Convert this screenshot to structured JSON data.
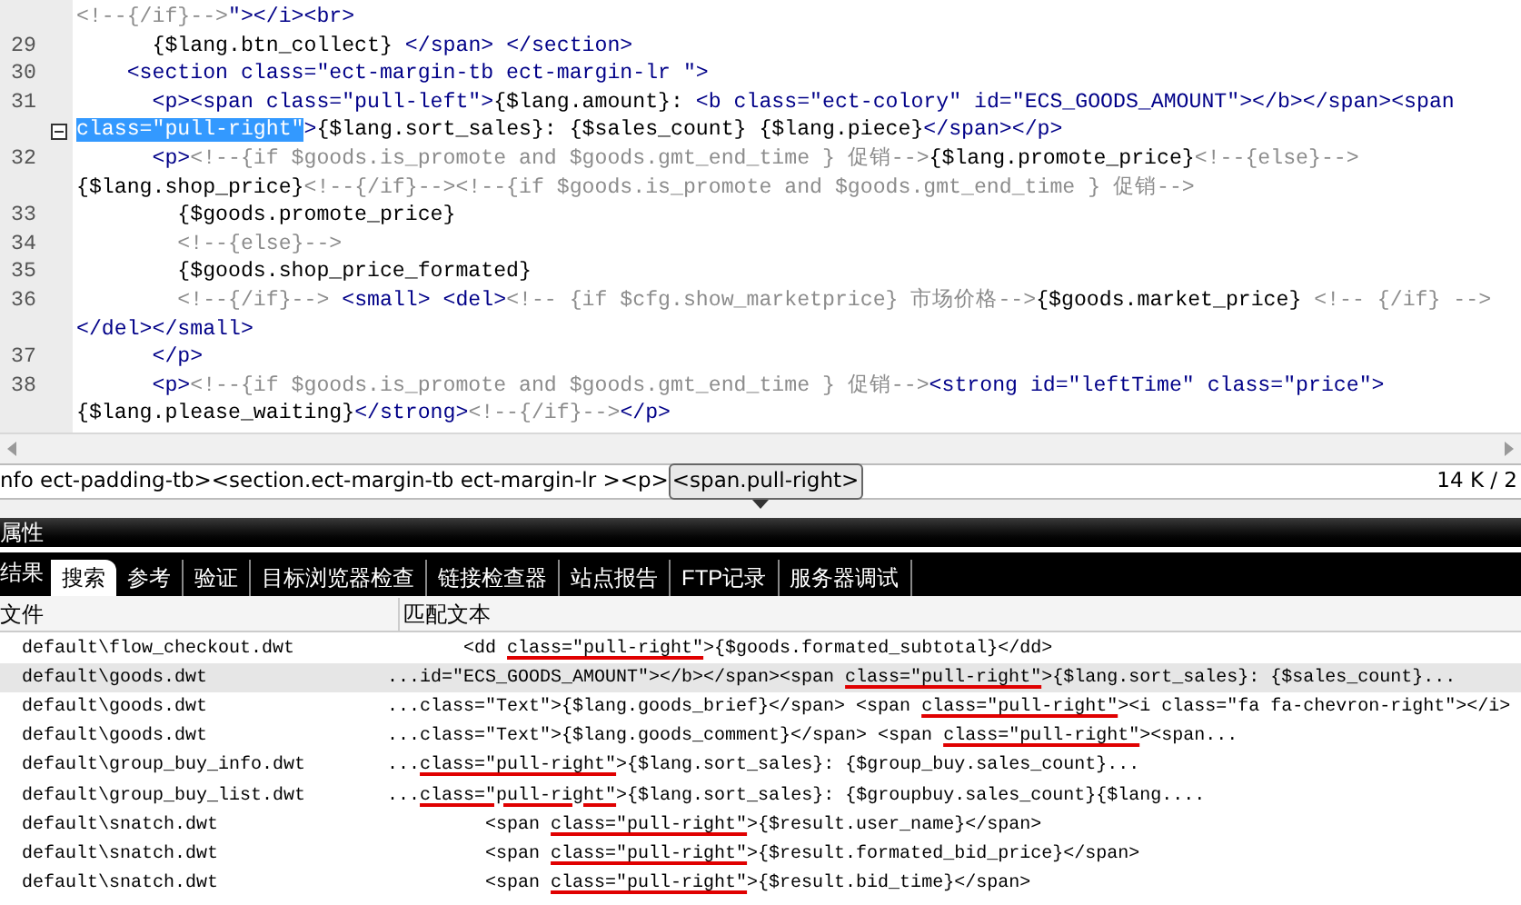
{
  "editor": {
    "lines": [
      {
        "fold": false,
        "segments": [
          {
            "kind": "comment",
            "text": "<!--{/if}-->"
          },
          {
            "kind": "tag",
            "text": "\"></i><br>"
          }
        ]
      },
      {
        "number": "29",
        "fold": false,
        "segments": [
          {
            "kind": "code",
            "text": "      {$lang.btn_collect} "
          },
          {
            "kind": "tag",
            "text": "</span> </section>"
          }
        ]
      },
      {
        "number": "30",
        "fold": false,
        "segments": [
          {
            "kind": "tag",
            "text": "    <section class=\"ect-margin-tb ect-margin-lr \">"
          }
        ]
      },
      {
        "number": "31",
        "fold": false,
        "segments": [
          {
            "kind": "tag",
            "text": "      <p><span class=\"pull-left\">"
          },
          {
            "kind": "code",
            "text": "{$lang.amount}: "
          },
          {
            "kind": "tag",
            "text": "<b class=\"ect-colory\" id=\"ECS_GOODS_AMOUNT\"></b></span><span"
          }
        ]
      },
      {
        "fold": true,
        "segments": [
          {
            "kind": "selection",
            "text": "class=\"pull-right\""
          },
          {
            "kind": "tag",
            "text": ">"
          },
          {
            "kind": "code",
            "text": "{$lang.sort_sales}: {$sales_count} {$lang.piece}"
          },
          {
            "kind": "tag",
            "text": "</span></p>"
          }
        ]
      },
      {
        "number": "32",
        "fold": false,
        "segments": [
          {
            "kind": "tag",
            "text": "      <p>"
          },
          {
            "kind": "comment",
            "text": "<!--{if $goods.is_promote and $goods.gmt_end_time } 促销-->"
          },
          {
            "kind": "code",
            "text": "{$lang.promote_price}"
          },
          {
            "kind": "comment",
            "text": "<!--{else}-->"
          }
        ]
      },
      {
        "fold": false,
        "segments": [
          {
            "kind": "code",
            "text": "{$lang.shop_price}"
          },
          {
            "kind": "comment",
            "text": "<!--{/if}--><!--{if $goods.is_promote and $goods.gmt_end_time } 促销-->"
          }
        ]
      },
      {
        "number": "33",
        "fold": false,
        "segments": [
          {
            "kind": "code",
            "text": "        {$goods.promote_price}"
          }
        ]
      },
      {
        "number": "34",
        "fold": false,
        "segments": [
          {
            "kind": "comment",
            "text": "        <!--{else}-->"
          }
        ]
      },
      {
        "number": "35",
        "fold": false,
        "segments": [
          {
            "kind": "code",
            "text": "        {$goods.shop_price_formated}"
          }
        ]
      },
      {
        "number": "36",
        "fold": false,
        "segments": [
          {
            "kind": "comment",
            "text": "        <!--{/if}--> "
          },
          {
            "kind": "tag",
            "text": "<small> <del>"
          },
          {
            "kind": "comment",
            "text": "<!-- {if $cfg.show_marketprice} 市场价格-->"
          },
          {
            "kind": "code",
            "text": "{$goods.market_price} "
          },
          {
            "kind": "comment",
            "text": "<!-- {/if} -->"
          }
        ]
      },
      {
        "fold": false,
        "segments": [
          {
            "kind": "tag",
            "text": "</del></small>"
          }
        ]
      },
      {
        "number": "37",
        "fold": false,
        "segments": [
          {
            "kind": "tag",
            "text": "      </p>"
          }
        ]
      },
      {
        "number": "38",
        "fold": false,
        "segments": [
          {
            "kind": "tag",
            "text": "      <p>"
          },
          {
            "kind": "comment",
            "text": "<!--{if $goods.is_promote and $goods.gmt_end_time } 促销-->"
          },
          {
            "kind": "tag",
            "text": "<strong id=\"leftTime\" class=\"price\">"
          }
        ]
      },
      {
        "fold": false,
        "segments": [
          {
            "kind": "code",
            "text": "{$lang.please_waiting}"
          },
          {
            "kind": "tag",
            "text": "</strong>"
          },
          {
            "kind": "comment",
            "text": "<!--{/if}-->"
          },
          {
            "kind": "tag",
            "text": "</p>"
          }
        ]
      }
    ]
  },
  "tag_selector": {
    "items": [
      {
        "label": "nfo ect-padding-tb>",
        "selected": false
      },
      {
        "label": "<section.ect-margin-tb ect-margin-lr >",
        "selected": false
      },
      {
        "label": "<p>",
        "selected": false
      },
      {
        "label": "<span.pull-right>",
        "selected": true
      }
    ],
    "size": "14 K / 2"
  },
  "properties_panel": {
    "title": "属性"
  },
  "results_panel": {
    "title": "结果",
    "tabs": [
      {
        "label": "搜索",
        "selected": true
      },
      {
        "label": "参考",
        "selected": false
      },
      {
        "label": "验证",
        "selected": false
      },
      {
        "label": "目标浏览器检查",
        "selected": false
      },
      {
        "label": "链接检查器",
        "selected": false
      },
      {
        "label": "站点报告",
        "selected": false
      },
      {
        "label": "FTP记录",
        "selected": false
      },
      {
        "label": "服务器调试",
        "selected": false
      }
    ],
    "columns": [
      "文件",
      "匹配文本"
    ],
    "rows": [
      {
        "file": "default\\flow_checkout.dwt",
        "selected": false,
        "match": [
          {
            "text": "       <dd ",
            "hit": false
          },
          {
            "text": "class=\"pull-right\"",
            "hit": true
          },
          {
            "text": ">{$goods.formated_subtotal}</dd>",
            "hit": false
          }
        ]
      },
      {
        "file": "default\\goods.dwt",
        "selected": true,
        "match": [
          {
            "text": "...id=\"ECS_GOODS_AMOUNT\"></b></span><span ",
            "hit": false
          },
          {
            "text": "class=\"pull-right\"",
            "hit": true
          },
          {
            "text": ">{$lang.sort_sales}: {$sales_count}...",
            "hit": false
          }
        ]
      },
      {
        "file": "default\\goods.dwt",
        "selected": false,
        "match": [
          {
            "text": "...class=\"Text\">{$lang.goods_brief}</span> <span ",
            "hit": false
          },
          {
            "text": "class=\"pull-right\"",
            "hit": true
          },
          {
            "text": "><i class=\"fa fa-chevron-right\"></i>",
            "hit": false
          }
        ]
      },
      {
        "file": "default\\goods.dwt",
        "selected": false,
        "match": [
          {
            "text": "...class=\"Text\">{$lang.goods_comment}</span> <span ",
            "hit": false
          },
          {
            "text": "class=\"pull-right\"",
            "hit": true
          },
          {
            "text": "><span...",
            "hit": false
          }
        ]
      },
      {
        "file": "default\\group_buy_info.dwt",
        "selected": false,
        "match": [
          {
            "text": "...",
            "hit": false
          },
          {
            "text": "class=\"pull-right\"",
            "hit": true
          },
          {
            "text": ">{$lang.sort_sales}: {$group_buy.sales_count}...",
            "hit": false
          }
        ]
      },
      {
        "file": "default\\group_buy_list.dwt",
        "selected": false,
        "match": [
          {
            "text": "...",
            "hit": false
          },
          {
            "text": "class=\"pull-right\"",
            "hit": true
          },
          {
            "text": ">{$lang.sort_sales}: {$groupbuy.sales_count}{$lang....",
            "hit": false
          }
        ]
      },
      {
        "file": "default\\snatch.dwt",
        "selected": false,
        "match": [
          {
            "text": "         <span ",
            "hit": false
          },
          {
            "text": "class=\"pull-right\"",
            "hit": true
          },
          {
            "text": ">{$result.user_name}</span>",
            "hit": false
          }
        ]
      },
      {
        "file": "default\\snatch.dwt",
        "selected": false,
        "match": [
          {
            "text": "         <span ",
            "hit": false
          },
          {
            "text": "class=\"pull-right\"",
            "hit": true
          },
          {
            "text": ">{$result.formated_bid_price}</span>",
            "hit": false
          }
        ]
      },
      {
        "file": "default\\snatch.dwt",
        "selected": false,
        "match": [
          {
            "text": "         <span ",
            "hit": false
          },
          {
            "text": "class=\"pull-right\"",
            "hit": true
          },
          {
            "text": ">{$result.bid_time}</span>",
            "hit": false
          }
        ]
      }
    ]
  }
}
